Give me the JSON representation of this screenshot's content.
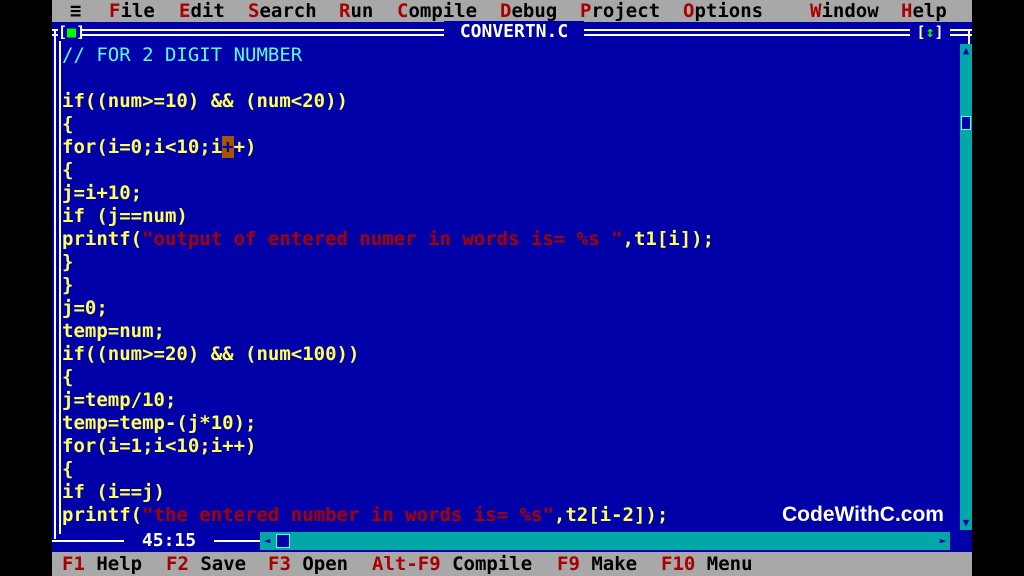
{
  "menubar": {
    "system": "≡",
    "items": [
      {
        "hotkey": "F",
        "rest": "ile"
      },
      {
        "hotkey": "E",
        "rest": "dit"
      },
      {
        "hotkey": "S",
        "rest": "earch"
      },
      {
        "hotkey": "R",
        "rest": "un"
      },
      {
        "hotkey": "C",
        "rest": "ompile"
      },
      {
        "hotkey": "D",
        "rest": "ebug"
      },
      {
        "hotkey": "P",
        "rest": "roject"
      },
      {
        "hotkey": "O",
        "rest": "ptions"
      },
      {
        "hotkey": "W",
        "rest": "indow"
      },
      {
        "hotkey": "H",
        "rest": "elp"
      }
    ]
  },
  "window": {
    "title": "CONVERTN.C",
    "close_icon": "■",
    "zoom_icon": "↕",
    "position": "45:15"
  },
  "code": {
    "l0": "// FOR 2 DIGIT NUMBER",
    "l2": "if((num>=10) && (num<20))",
    "l3": "{",
    "l4a": "for(i=0;i<10;i",
    "l4b": "+",
    "l4c": "+)",
    "l5": "{",
    "l6": "j=i+10;",
    "l7": "if (j==num)",
    "l8a": "printf(",
    "l8b": "\"output of entered numer in words is= %s \"",
    "l8c": ",t1[i]);",
    "l9": "}",
    "l10": "}",
    "l11": "j=0;",
    "l12": "temp=num;",
    "l13": "if((num>=20) && (num<100))",
    "l14": "{",
    "l15": "j=temp/10;",
    "l16": "temp=temp-(j*10);",
    "l17": "for(i=1;i<10;i++)",
    "l18": "{",
    "l19": "if (i==j)",
    "l20a": "printf(",
    "l20b": "\"the entered number in words is= %s\"",
    "l20c": ",t2[i-2]);"
  },
  "fkeys": [
    {
      "key": "F1",
      "label": "Help"
    },
    {
      "key": "F2",
      "label": "Save"
    },
    {
      "key": "F3",
      "label": "Open"
    },
    {
      "key": "Alt-F9",
      "label": "Compile"
    },
    {
      "key": "F9",
      "label": "Make"
    },
    {
      "key": "F10",
      "label": "Menu"
    }
  ],
  "watermark": "CodeWithC.com",
  "colors": {
    "editor_bg": "#0000a8",
    "code_text": "#ffff55",
    "comment": "#55ffff",
    "string": "#a80000",
    "menu_bg": "#a8a8a8",
    "hotkey": "#a80000"
  }
}
